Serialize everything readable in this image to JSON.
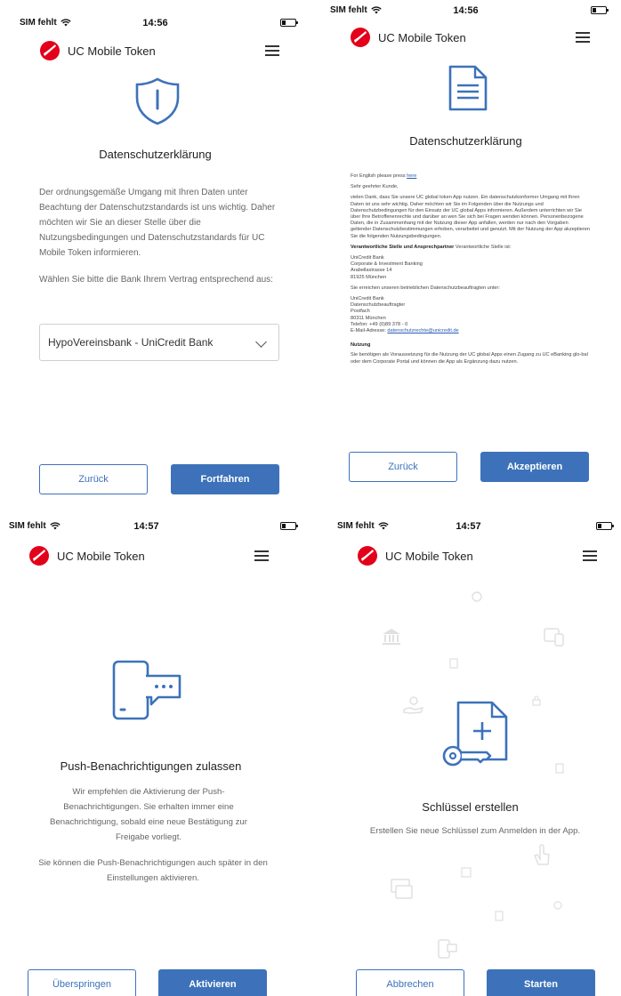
{
  "status": {
    "carrier": "SIM fehlt",
    "times": [
      "14:56",
      "14:56",
      "14:57",
      "14:57"
    ]
  },
  "app": {
    "title": "UC Mobile Token",
    "brand_color": "#e2001a",
    "accent_color": "#3d72ba"
  },
  "screen1": {
    "title": "Datenschutzerklärung",
    "paragraph": "Der ordnungsgemäße Umgang mit Ihren Daten unter Beachtung der Datenschutzstandards ist uns wichtig. Daher möchten wir Sie an dieser Stelle über die Nutzungsbedingungen und Datenschutzstandards für UC Mobile Token informieren.",
    "bank_prompt": "Wählen Sie bitte die Bank Ihrem Vertrag entsprechend aus:",
    "bank_selected": "HypoVereinsbank - UniCredit Bank",
    "back": "Zurück",
    "continue": "Fortfahren"
  },
  "screen2": {
    "title": "Datenschutzerklärung",
    "english_prefix": "For English please press",
    "english_link": "here",
    "greeting": "Sehr geehrter Kunde,",
    "intro": "vielen Dank, dass Sie unsere UC global token App nutzen. Ein datenschutzkonformer Umgang mit Ihren Daten ist uns sehr wichtig. Daher möchten wir Sie im Folgenden über die Nutzungs und Datenschutzbedingungen für den Einsatz der UC global Apps informieren. Außerdem unterrichten wir Sie über Ihre Betroffenenrechte und darüber an wen Sie sich bei Fragen wenden können. Personenbezogene Daten, die in Zusammenhang mit der Nutzung dieser App anfallen, werden nur nach den Vorgaben geltender Datenschutzbestimmungen erhoben, verarbeitet und genutzt. Mit der Nutzung der App akzeptieren Sie die folgenden Nutzungsbedingungen.",
    "resp_heading": "Verantwortliche Stelle und Ansprechpartner",
    "resp_text": "Verantwortliche Stelle ist:",
    "address1": "UniCredit Bank\nCorporate & Investment Banking\nArabellastrasse 14\n81925 München",
    "dpo_text": "Sie erreichen unseren betrieblichen Datenschutzbeauftragten unter:",
    "address2": "UniCredit Bank\nDatenschutzbeauftragter\nPostfach\n80311 München\nTelefon: +49 (0)89 378 - 0",
    "email_label": "E-Mail-Adresse:",
    "email": "datenschutzrechte@unicredit.de",
    "usage_heading": "Nutzung",
    "usage_text": "Sie benötigen als Voraussetzung für die Nutzung der UC global Apps einen Zugang zu UC eBanking glo-bal oder dem Corporate Portal und können die App als Ergänzung dazu nutzen.",
    "back": "Zurück",
    "accept": "Akzeptieren"
  },
  "screen3": {
    "title": "Push-Benachrichtigungen zulassen",
    "para1": "Wir empfehlen die Aktivierung der Push-Benachrichtigungen. Sie erhalten immer eine Benachrichtigung, sobald eine neue Bestätigung zur Freigabe vorliegt.",
    "para2": "Sie können die Push-Benachrichtigungen auch später in den Einstellungen aktivieren.",
    "skip": "Überspringen",
    "activate": "Aktivieren"
  },
  "screen4": {
    "title": "Schlüssel erstellen",
    "para": "Erstellen Sie neue Schlüssel zum Anmelden in der App.",
    "cancel": "Abbrechen",
    "start": "Starten"
  }
}
